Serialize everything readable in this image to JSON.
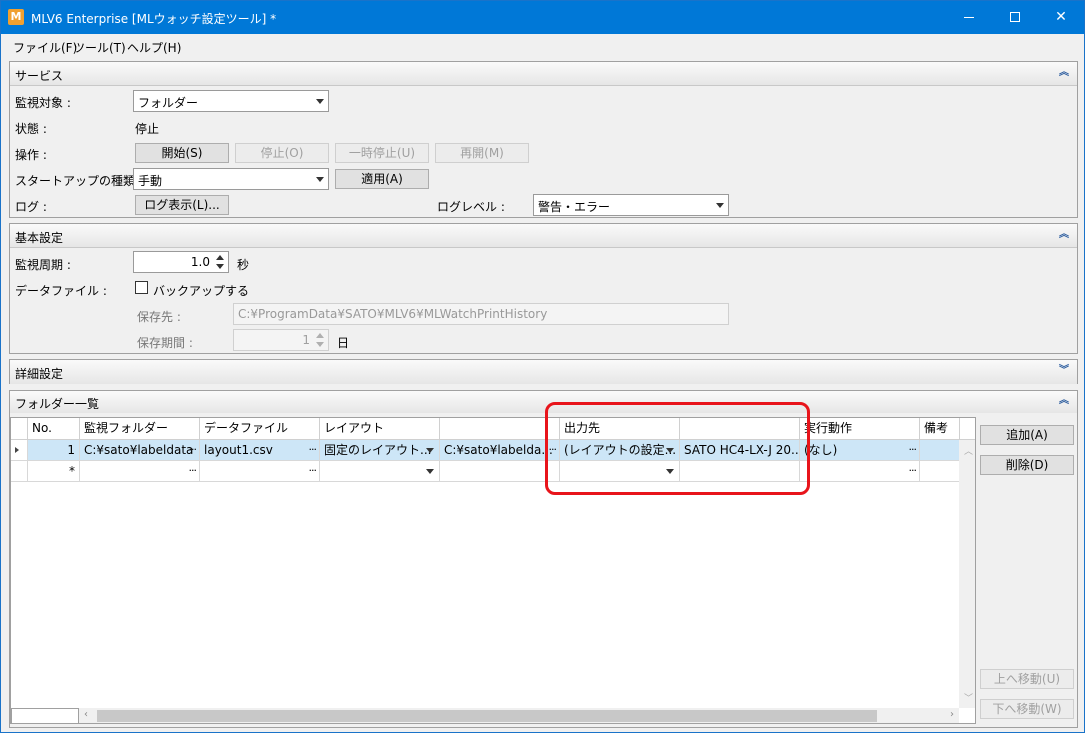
{
  "window": {
    "title": "MLV6 Enterprise [MLウォッチ設定ツール] *",
    "icon_letter": "M"
  },
  "menu": [
    "ファイル(F)",
    "ツール(T)",
    "ヘルプ(H)"
  ],
  "service": {
    "title": "サービス",
    "target_label": "監視対象 :",
    "target_value": "フォルダー",
    "status_label": "状態 :",
    "status_value": "停止",
    "ops_label": "操作 :",
    "start_btn": "開始(S)",
    "stop_btn": "停止(O)",
    "pause_btn": "一時停止(U)",
    "resume_btn": "再開(M)",
    "startup_label": "スタートアップの種類 :",
    "startup_value": "手動",
    "apply_btn": "適用(A)",
    "log_label": "ログ :",
    "log_btn": "ログ表示(L)...",
    "loglevel_label": "ログレベル :",
    "loglevel_value": "警告・エラー"
  },
  "basic": {
    "title": "基本設定",
    "interval_label": "監視周期 :",
    "interval_value": "1.0",
    "interval_unit": "秒",
    "datafile_label": "データファイル :",
    "backup_label": "バックアップする",
    "save_to_label": "保存先 :",
    "save_to_value": "C:¥ProgramData¥SATO¥MLV6¥MLWatchPrintHistory",
    "retention_label": "保存期間 :",
    "retention_value": "1",
    "retention_unit": "日"
  },
  "detail": {
    "title": "詳細設定"
  },
  "folders": {
    "title": "フォルダー一覧",
    "headers": [
      "No.",
      "監視フォルダー",
      "データファイル",
      "レイアウト",
      "",
      "出力先",
      "",
      "実行動作",
      "備考"
    ],
    "row1": {
      "no": "1",
      "folder": "C:¥sato¥labeldata",
      "datafile": "layout1.csv",
      "layout": "固定のレイアウト...",
      "layout_path": "C:¥sato¥labelda...",
      "output": "(レイアウトの設定...",
      "printer": "SATO HC4-LX-J 20...",
      "action": "(なし)"
    },
    "row2": {
      "marker": "*"
    },
    "add_btn": "追加(A)",
    "delete_btn": "削除(D)",
    "up_btn": "上へ移動(U)",
    "down_btn": "下へ移動(W)"
  },
  "colors": {
    "titlebar": "#0078d7",
    "highlight": "#e8141b",
    "selection": "#cde6f7"
  }
}
